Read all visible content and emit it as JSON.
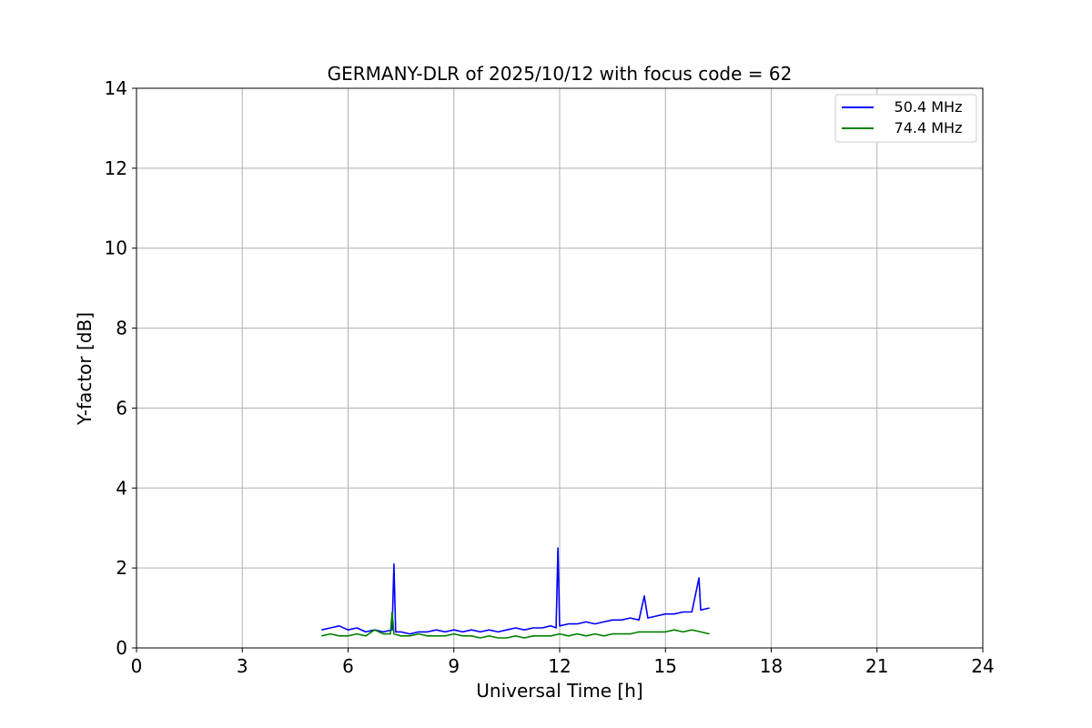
{
  "chart_data": {
    "type": "line",
    "title": "GERMANY-DLR of 2025/10/12 with focus code = 62",
    "xlabel": "Universal Time [h]",
    "ylabel": "Y-factor [dB]",
    "xlim": [
      0,
      24
    ],
    "ylim": [
      0,
      14
    ],
    "xticks": [
      "0",
      "3",
      "6",
      "9",
      "12",
      "15",
      "18",
      "21",
      "24"
    ],
    "yticks": [
      "0",
      "2",
      "4",
      "6",
      "8",
      "10",
      "12",
      "14"
    ],
    "grid": true,
    "legend_position": "top-right",
    "series": [
      {
        "name": "50.4 MHz",
        "color": "#0000ff",
        "x": [
          5.25,
          5.5,
          5.75,
          6.0,
          6.25,
          6.5,
          6.75,
          7.0,
          7.25,
          7.3,
          7.35,
          7.5,
          7.75,
          8.0,
          8.25,
          8.5,
          8.75,
          9.0,
          9.25,
          9.5,
          9.75,
          10.0,
          10.25,
          10.5,
          10.75,
          11.0,
          11.25,
          11.5,
          11.75,
          11.9,
          11.95,
          12.0,
          12.25,
          12.5,
          12.75,
          13.0,
          13.25,
          13.5,
          13.75,
          14.0,
          14.25,
          14.4,
          14.5,
          14.75,
          15.0,
          15.25,
          15.5,
          15.75,
          15.95,
          16.0,
          16.25
        ],
        "y": [
          0.45,
          0.5,
          0.55,
          0.45,
          0.5,
          0.4,
          0.45,
          0.4,
          0.45,
          2.1,
          0.4,
          0.4,
          0.35,
          0.4,
          0.4,
          0.45,
          0.4,
          0.45,
          0.4,
          0.45,
          0.4,
          0.45,
          0.4,
          0.45,
          0.5,
          0.45,
          0.5,
          0.5,
          0.55,
          0.5,
          2.5,
          0.55,
          0.6,
          0.6,
          0.65,
          0.6,
          0.65,
          0.7,
          0.7,
          0.75,
          0.7,
          1.3,
          0.75,
          0.8,
          0.85,
          0.85,
          0.9,
          0.9,
          1.75,
          0.95,
          1.0
        ]
      },
      {
        "name": "74.4 MHz",
        "color": "#008000",
        "x": [
          5.25,
          5.5,
          5.75,
          6.0,
          6.25,
          6.5,
          6.75,
          7.0,
          7.2,
          7.25,
          7.3,
          7.5,
          7.75,
          8.0,
          8.25,
          8.5,
          8.75,
          9.0,
          9.25,
          9.5,
          9.75,
          10.0,
          10.25,
          10.5,
          10.75,
          11.0,
          11.25,
          11.5,
          11.75,
          12.0,
          12.25,
          12.5,
          12.75,
          13.0,
          13.25,
          13.5,
          13.75,
          14.0,
          14.25,
          14.5,
          14.75,
          15.0,
          15.25,
          15.5,
          15.75,
          16.0,
          16.25
        ],
        "y": [
          0.3,
          0.35,
          0.3,
          0.3,
          0.35,
          0.3,
          0.45,
          0.35,
          0.35,
          0.9,
          0.35,
          0.3,
          0.3,
          0.35,
          0.3,
          0.3,
          0.3,
          0.35,
          0.3,
          0.3,
          0.25,
          0.3,
          0.25,
          0.25,
          0.3,
          0.25,
          0.3,
          0.3,
          0.3,
          0.35,
          0.3,
          0.35,
          0.3,
          0.35,
          0.3,
          0.35,
          0.35,
          0.35,
          0.4,
          0.4,
          0.4,
          0.4,
          0.45,
          0.4,
          0.45,
          0.4,
          0.35
        ]
      }
    ]
  }
}
